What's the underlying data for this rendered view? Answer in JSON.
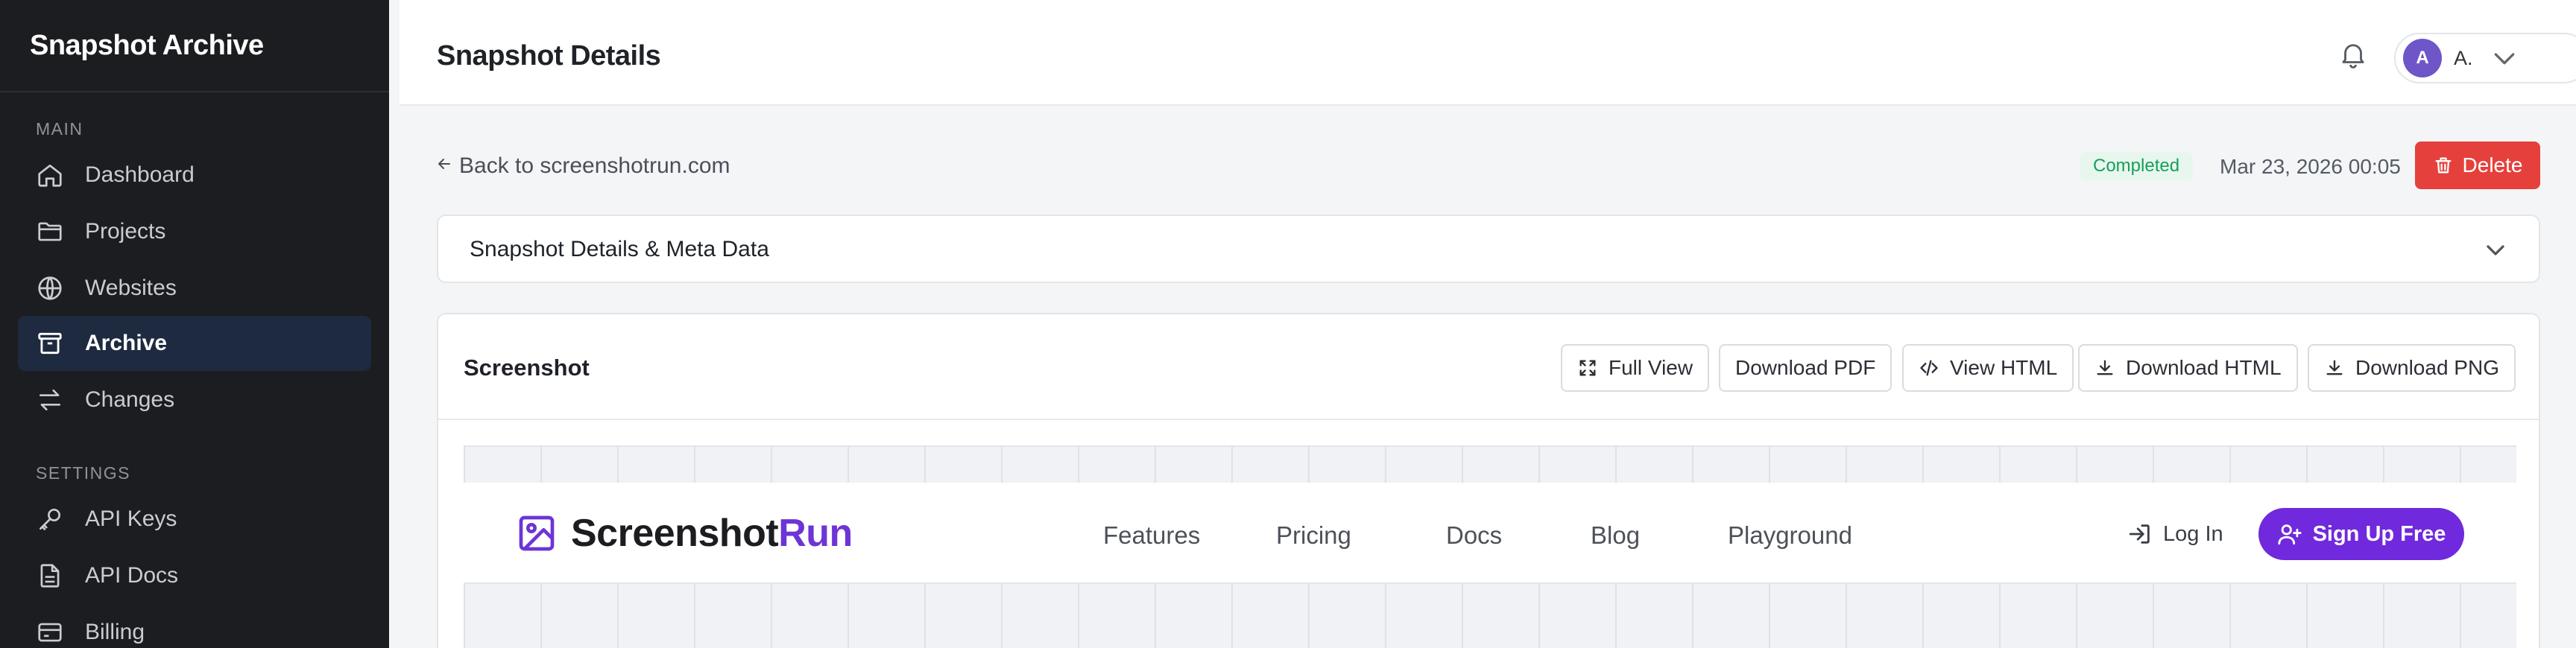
{
  "sidebar": {
    "brand": "Snapshot Archive",
    "sections": {
      "main": "MAIN",
      "settings": "SETTINGS"
    },
    "items": [
      {
        "label": "Dashboard",
        "icon": "home-icon",
        "active": false
      },
      {
        "label": "Projects",
        "icon": "folder-icon",
        "active": false
      },
      {
        "label": "Websites",
        "icon": "globe-icon",
        "active": false
      },
      {
        "label": "Archive",
        "icon": "archive-icon",
        "active": true
      },
      {
        "label": "Changes",
        "icon": "arrows-swap-icon",
        "active": false
      },
      {
        "label": "API Keys",
        "icon": "key-icon",
        "active": false
      },
      {
        "label": "API Docs",
        "icon": "document-icon",
        "active": false
      },
      {
        "label": "Billing",
        "icon": "credit-card-icon",
        "active": false
      }
    ]
  },
  "header": {
    "title": "Snapshot Details",
    "user": {
      "initial": "A",
      "name": "A."
    }
  },
  "toolbar": {
    "back_label": "Back to screenshotrun.com",
    "status": "Completed",
    "timestamp": "Mar 23, 2026 00:05",
    "delete_label": "Delete"
  },
  "meta_panel": {
    "title": "Snapshot Details & Meta Data"
  },
  "screenshot_panel": {
    "title": "Screenshot",
    "actions": {
      "full_view": "Full View",
      "download_pdf": "Download PDF",
      "view_html": "View HTML",
      "download_html": "Download HTML",
      "download_png": "Download PNG"
    }
  },
  "preview": {
    "logo_part1": "Screenshot",
    "logo_part2": "Run",
    "nav": [
      "Features",
      "Pricing",
      "Docs",
      "Blog",
      "Playground"
    ],
    "login": "Log In",
    "signup": "Sign Up Free"
  },
  "colors": {
    "sidebar_bg": "#1c1d20",
    "active_item_bg": "#1e2a40",
    "status_green": "#16a05a",
    "delete_red": "#e5403b",
    "brand_purple": "#7029dc",
    "avatar_purple": "#6e56c9"
  }
}
